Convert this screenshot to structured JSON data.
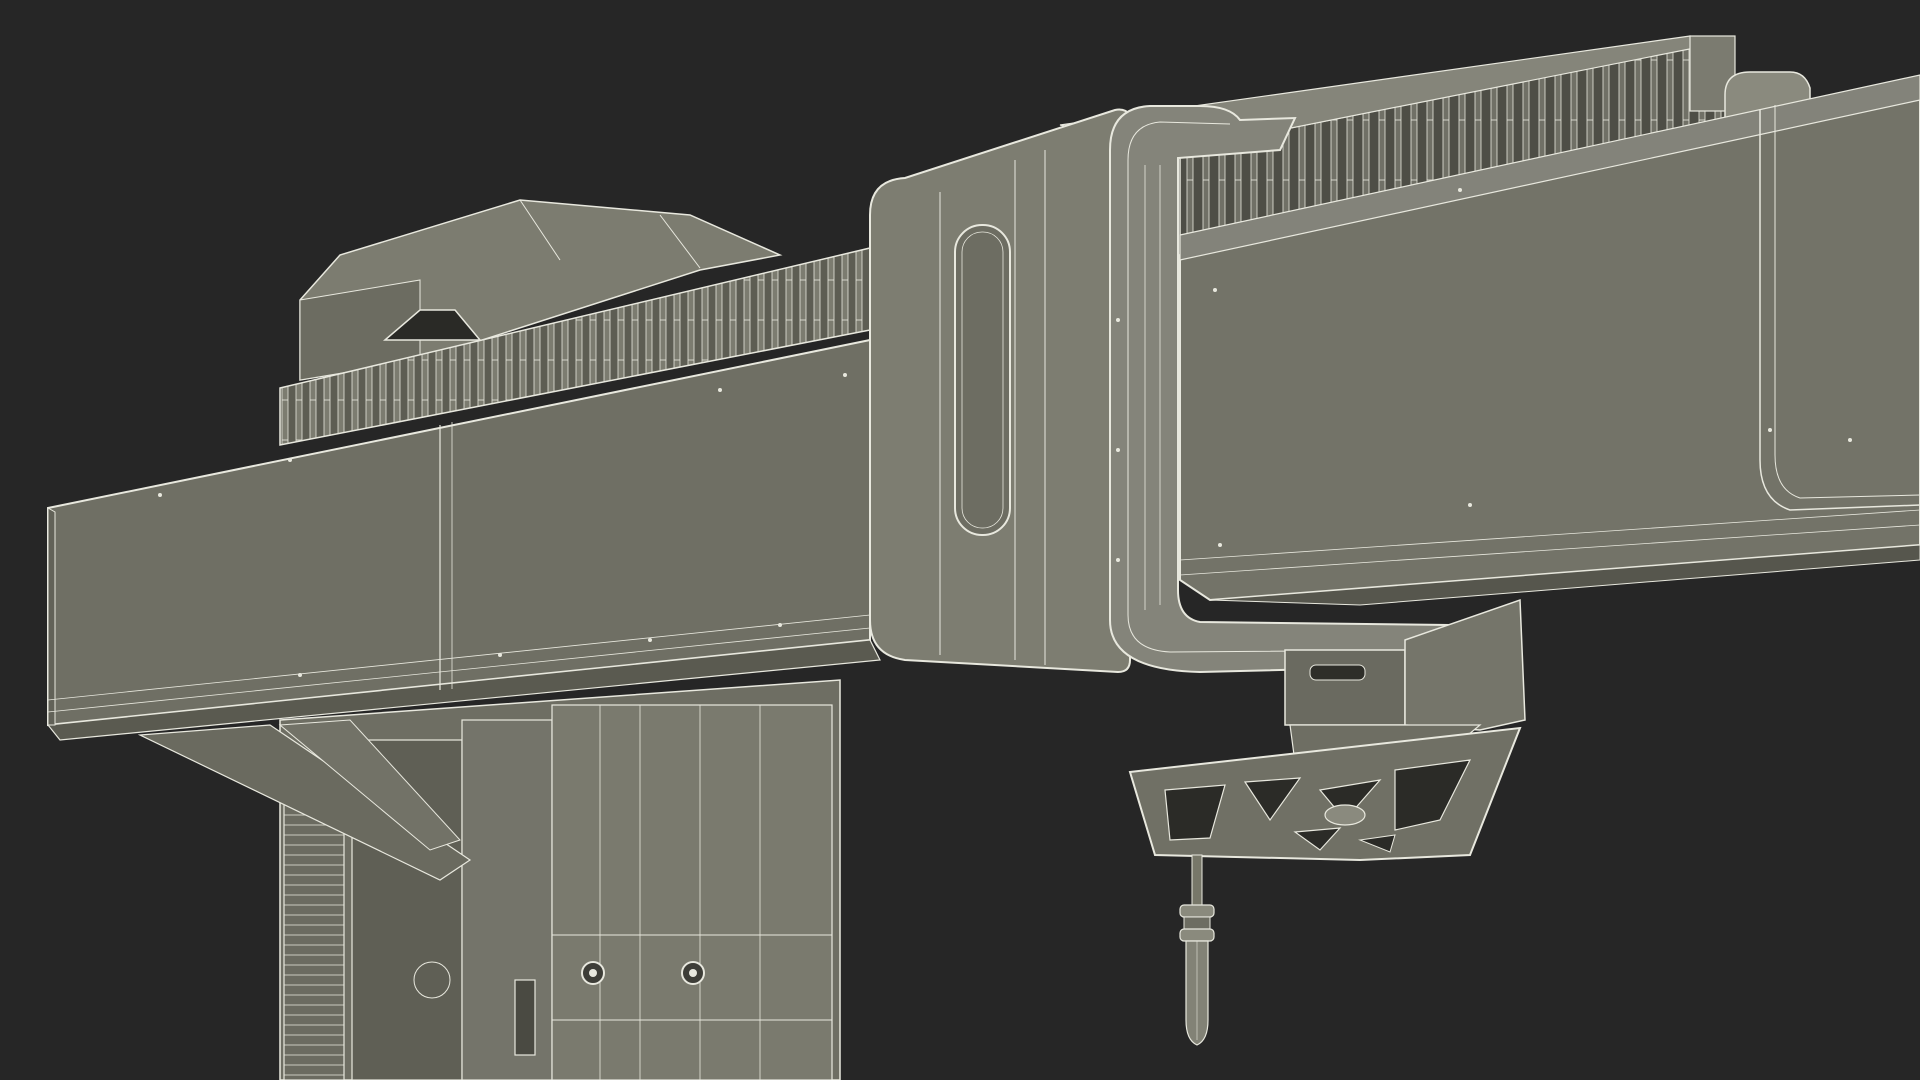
{
  "scene": {
    "subject": "wireframe-render-gantry-cnc-machine",
    "colors": {
      "background": "#262626",
      "surface": "#757568",
      "surface_dark": "#6a6a5e",
      "surface_light": "#80807a",
      "wire": "#e8e8de",
      "shadow": "#55554c"
    }
  }
}
